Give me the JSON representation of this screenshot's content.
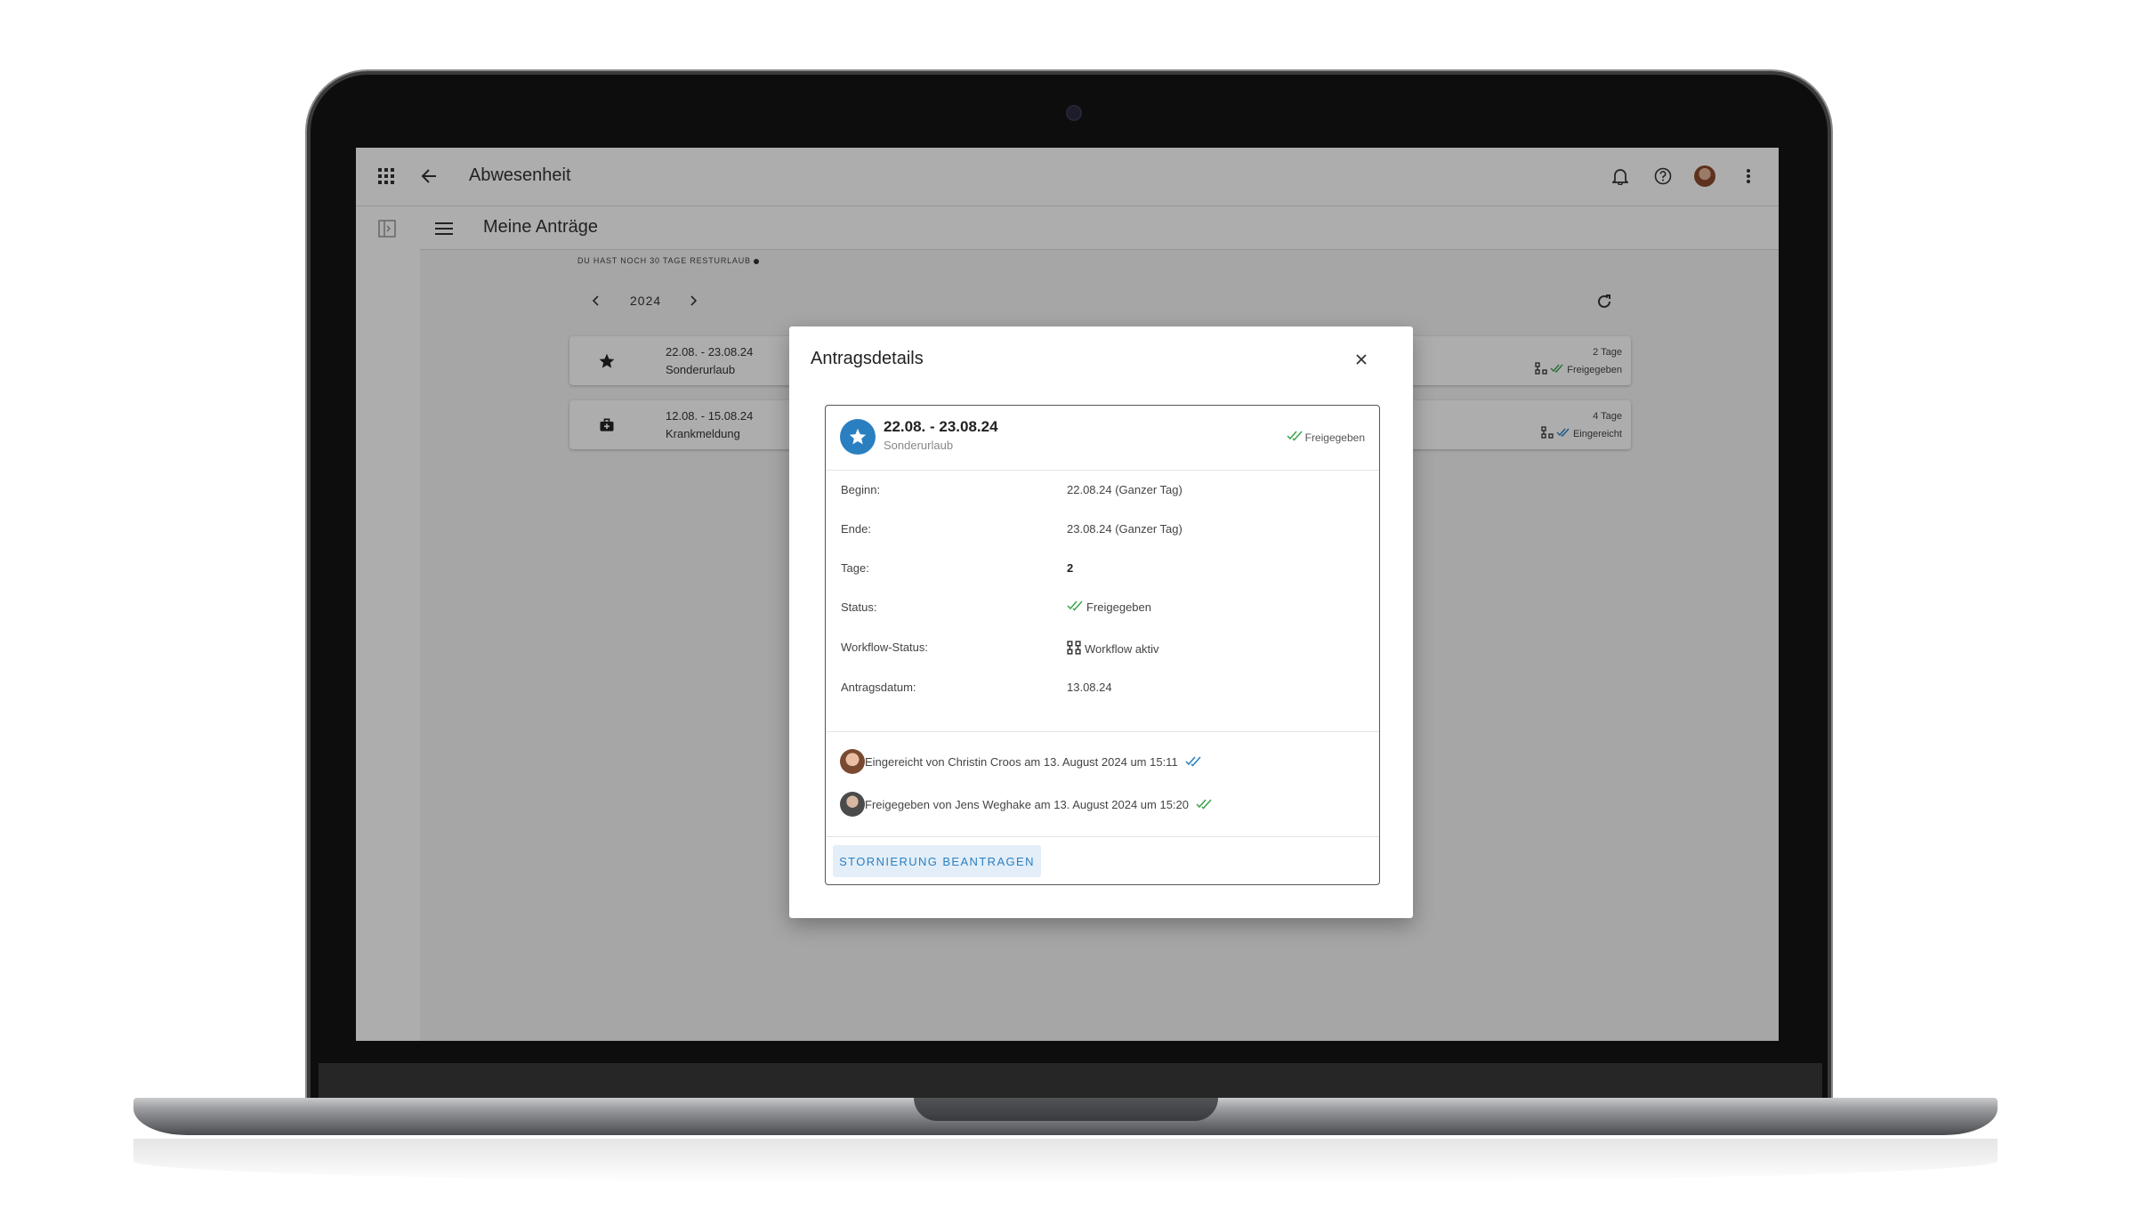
{
  "app": {
    "title": "Abwesenheit",
    "subtitle": "Meine Anträge"
  },
  "overview": {
    "remaining_text": "DU HAST NOCH 30 TAGE RESTURLAUB",
    "year": "2024",
    "requests": [
      {
        "icon": "star-icon",
        "date": "22.08. - 23.08.24",
        "type": "Sonderurlaub",
        "days": "2 Tage",
        "status": "Freigegeben"
      },
      {
        "icon": "medical-bag-icon",
        "date": "12.08. - 15.08.24",
        "type": "Krankmeldung",
        "days": "4 Tage",
        "status": "Eingereicht"
      }
    ]
  },
  "dialog": {
    "title": "Antragsdetails",
    "header_date": "22.08. - 23.08.24",
    "header_type": "Sonderurlaub",
    "header_status": "Freigegeben",
    "rows": [
      {
        "label": "Beginn:",
        "value": "22.08.24 (Ganzer Tag)"
      },
      {
        "label": "Ende:",
        "value": "23.08.24 (Ganzer Tag)"
      },
      {
        "label": "Tage:",
        "value": "2"
      },
      {
        "label": "Status:",
        "value": "Freigegeben"
      },
      {
        "label": "Workflow-Status:",
        "value": "Workflow aktiv"
      },
      {
        "label": "Antragsdatum:",
        "value": "13.08.24"
      }
    ],
    "history": [
      {
        "text": "Eingereicht von Christin Croos am 13. August 2024 um 15:11"
      },
      {
        "text": "Freigegeben von Jens Weghake am 13. August 2024 um 15:20"
      }
    ],
    "cancel_label": "STORNIERUNG BEANTRAGEN"
  },
  "colors": {
    "accent": "#2a7fc1",
    "approved": "#3aa34a",
    "submitted": "#2a7fc1"
  }
}
